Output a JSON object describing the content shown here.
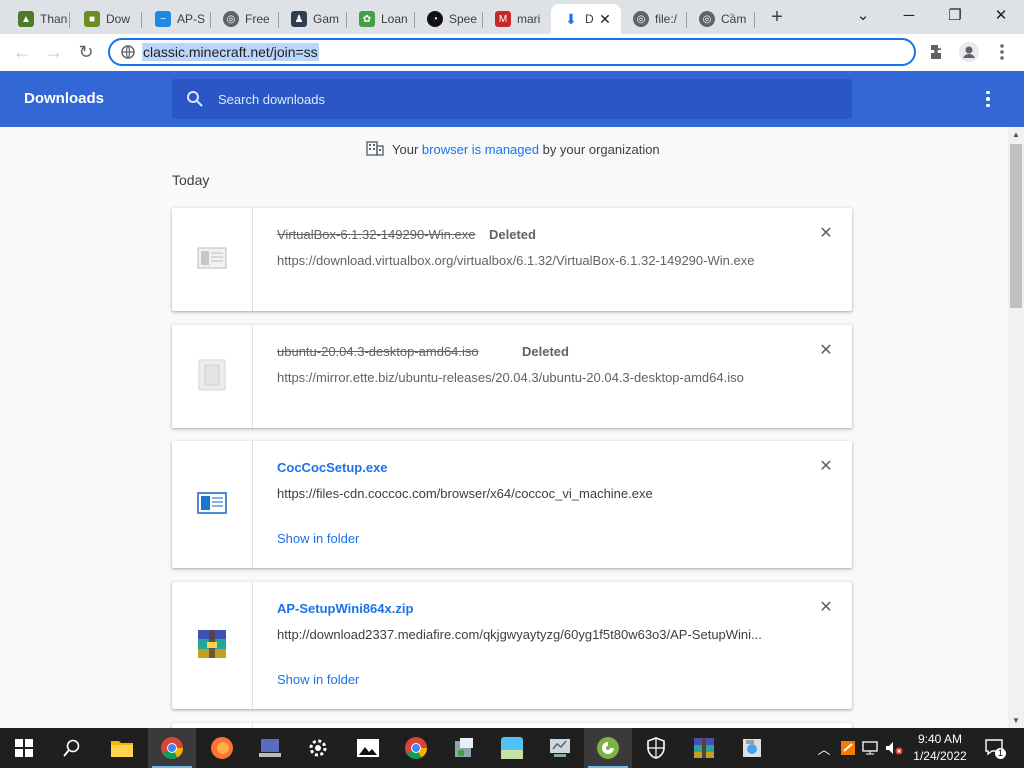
{
  "browser": {
    "tabs": [
      {
        "title": "Than",
        "favicon": "green-game-favicon",
        "color": "#4a7a2a"
      },
      {
        "title": "Dow",
        "favicon": "minecraft-favicon",
        "color": "#6b8e23"
      },
      {
        "title": "AP-S",
        "favicon": "blue-swirl-favicon",
        "color": "#1e88e5"
      },
      {
        "title": "Free",
        "favicon": "globe-favicon",
        "color": "#5f6368"
      },
      {
        "title": "Gam",
        "favicon": "dark-logo-favicon",
        "color": "#2c3e50"
      },
      {
        "title": "Loan",
        "favicon": "green-leaf-favicon",
        "color": "#43a047"
      },
      {
        "title": "Spee",
        "favicon": "speedtest-favicon",
        "color": "#111111"
      },
      {
        "title": "mari",
        "favicon": "mario-favicon",
        "color": "#c62828"
      },
      {
        "title": "D",
        "favicon": "download-favicon",
        "color": "#1a73e8"
      },
      {
        "title": "file:/",
        "favicon": "globe-favicon",
        "color": "#5f6368"
      },
      {
        "title": "Cầm",
        "favicon": "globe-favicon",
        "color": "#5f6368"
      }
    ],
    "active_tab_index": 8,
    "address": "classic.minecraft.net/join=ss"
  },
  "downloads": {
    "title": "Downloads",
    "search_placeholder": "Search downloads",
    "managed_prefix": "Your",
    "managed_link": "browser is managed",
    "managed_suffix": "by your organization",
    "section_label": "Today",
    "items": [
      {
        "filename": "VirtualBox-6.1.32-149290-Win.exe",
        "status": "Deleted",
        "url": "https://download.virtualbox.org/virtualbox/6.1.32/VirtualBox-6.1.32-149290-Win.exe",
        "icon": "exe-file-icon"
      },
      {
        "filename": "ubuntu-20.04.3-desktop-amd64.iso",
        "status": "Deleted",
        "url": "https://mirror.ette.biz/ubuntu-releases/20.04.3/ubuntu-20.04.3-desktop-amd64.iso",
        "icon": "iso-file-icon"
      },
      {
        "filename": "CocCocSetup.exe",
        "status": "",
        "url": "https://files-cdn.coccoc.com/browser/x64/coccoc_vi_machine.exe",
        "action": "Show in folder",
        "icon": "exe-file-icon"
      },
      {
        "filename": "AP-SetupWini864x.zip",
        "status": "",
        "url": "http://download2337.mediafire.com/qkjgwyaytyzg/60yg1f5t80w63o3/AP-SetupWini...",
        "action": "Show in folder",
        "icon": "winrar-archive-icon"
      }
    ]
  },
  "taskbar": {
    "time": "9:40 AM",
    "date": "1/24/2022",
    "notification_count": "1"
  }
}
